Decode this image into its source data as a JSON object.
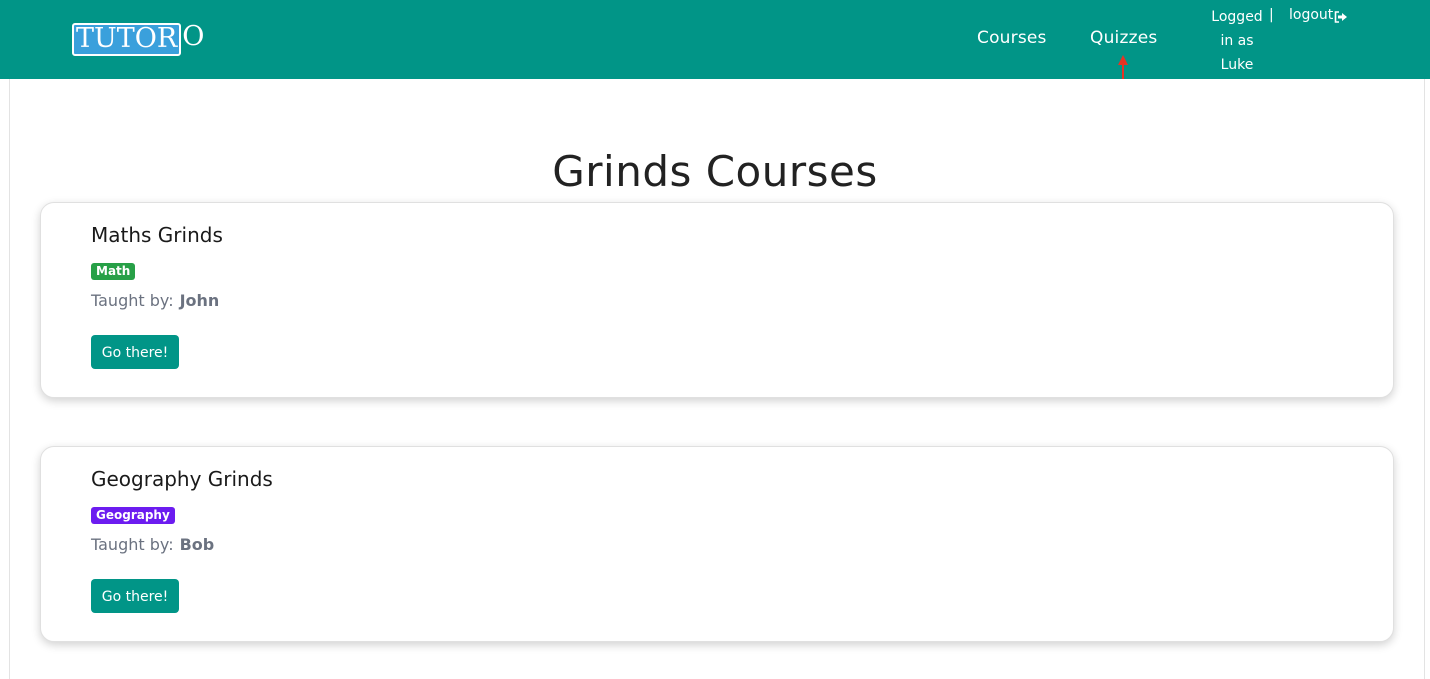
{
  "brand": {
    "logo_boxed": "TUTOR",
    "logo_tail": "O"
  },
  "nav": {
    "courses_label": "Courses",
    "quizzes_label": "Quizzes",
    "user_line1": "Logged",
    "user_line2": "in as",
    "user_line3": "Luke",
    "separator": "|",
    "logout_label": "logout",
    "logout_icon": "logout-icon"
  },
  "annotation": {
    "arrow_color": "#e63323"
  },
  "page": {
    "title": "Grinds Courses"
  },
  "courses": [
    {
      "title": "Maths Grinds",
      "tag": "Math",
      "tag_color": "#27a047",
      "taught_by_label": "Taught by:",
      "teacher": "John",
      "button_label": "Go there!"
    },
    {
      "title": "Geography Grinds",
      "tag": "Geography",
      "tag_color": "#6c1cf0",
      "taught_by_label": "Taught by:",
      "teacher": "Bob",
      "button_label": "Go there!"
    }
  ],
  "colors": {
    "primary": "#019587",
    "text_muted": "#6b7280"
  }
}
